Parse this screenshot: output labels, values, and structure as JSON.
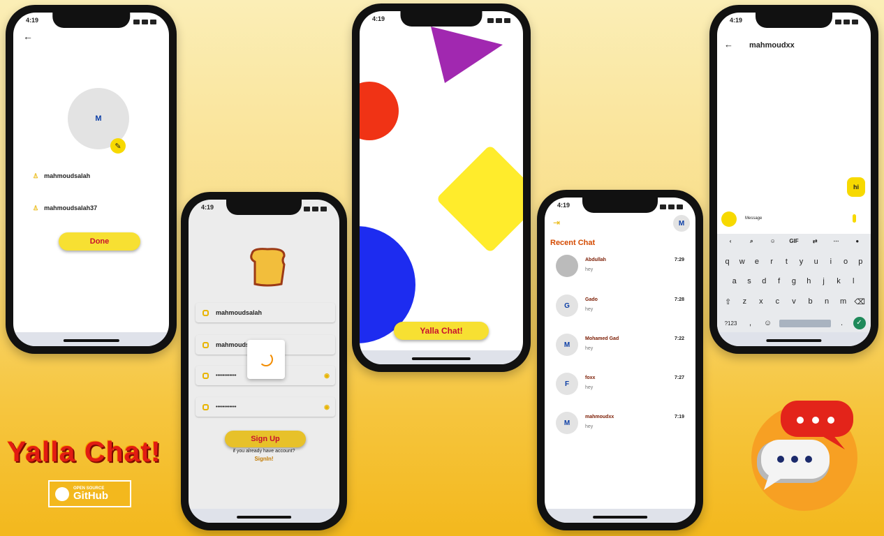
{
  "status_time": "4:19",
  "profile": {
    "avatar_letter": "M",
    "name_value": "mahmoudsalah",
    "username_value": "mahmoudsalah37",
    "done_label": "Done"
  },
  "signup": {
    "name_value": "mahmoudsalah",
    "username_value": "mahmoudsa",
    "password_value": "••••••••••••",
    "confirm_value": "••••••••••••",
    "signup_label": "Sign Up",
    "already_text": "if you already have account?",
    "signin_label": "SignIn!"
  },
  "welcome": {
    "button_label": "Yalla Chat!"
  },
  "recent": {
    "title": "Recent Chat",
    "avatar_letter": "M",
    "chats": [
      {
        "avatar": "",
        "name": "Abdullah",
        "msg": "hey",
        "time": "7:29"
      },
      {
        "avatar": "G",
        "name": "Gado",
        "msg": "hey",
        "time": "7:28"
      },
      {
        "avatar": "M",
        "name": "Mohamed Gad",
        "msg": "hey",
        "time": "7:22"
      },
      {
        "avatar": "F",
        "name": "foxx",
        "msg": "hey",
        "time": "7:27"
      },
      {
        "avatar": "M",
        "name": "mahmoudxx",
        "msg": "hey",
        "time": "7:19"
      }
    ]
  },
  "chat": {
    "contact_name": "mahmoudxx",
    "bubble_text": "hi",
    "input_placeholder": "Message",
    "kb_tools": [
      "GIF"
    ],
    "kb_row1": [
      "q",
      "w",
      "e",
      "r",
      "t",
      "y",
      "u",
      "i",
      "o",
      "p"
    ],
    "kb_row1_nums": [
      "1",
      "2",
      "3",
      "4",
      "5",
      "6",
      "7",
      "8",
      "9",
      "0"
    ],
    "kb_row2": [
      "a",
      "s",
      "d",
      "f",
      "g",
      "h",
      "j",
      "k",
      "l"
    ],
    "kb_row3": [
      "z",
      "x",
      "c",
      "v",
      "b",
      "n",
      "m"
    ],
    "kb_row4_key": "?123",
    "kb_comma": ","
  },
  "branding": {
    "app_title": "Yalla Chat!",
    "badge_small": "OPEN SOURCE",
    "badge_big": "GitHub"
  },
  "colors": {
    "accent_yellow": "#f7e032",
    "brand_red": "#c8102e",
    "shape_purple": "#a128b0",
    "shape_red": "#f03315",
    "shape_yellow": "#ffec2c",
    "shape_blue": "#1d2cf0"
  }
}
